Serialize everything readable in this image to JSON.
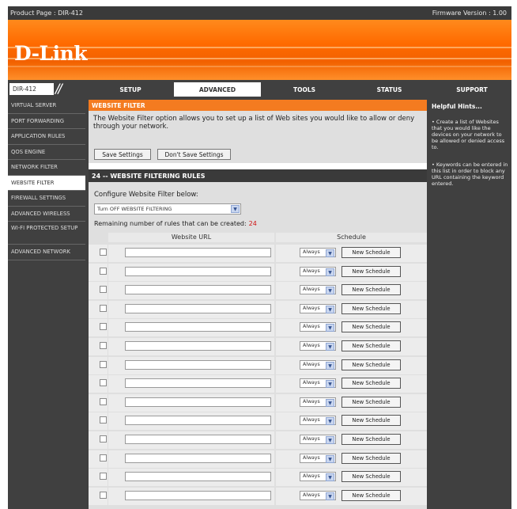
{
  "topbar": {
    "product": "Product Page : DIR-412",
    "firmware": "Firmware Version : 1.00"
  },
  "brand": {
    "logo": "D-Link"
  },
  "nav": {
    "model": "DIR-412",
    "tabs": [
      {
        "label": "SETUP",
        "active": false
      },
      {
        "label": "ADVANCED",
        "active": true
      },
      {
        "label": "TOOLS",
        "active": false
      },
      {
        "label": "STATUS",
        "active": false
      },
      {
        "label": "SUPPORT",
        "active": false
      }
    ]
  },
  "sidebar": {
    "items": [
      {
        "label": "VIRTUAL SERVER",
        "active": false
      },
      {
        "label": "PORT FORWARDING",
        "active": false
      },
      {
        "label": "APPLICATION RULES",
        "active": false
      },
      {
        "label": "QOS ENGINE",
        "active": false
      },
      {
        "label": "NETWORK FILTER",
        "active": false
      },
      {
        "label": "WEBSITE FILTER",
        "active": true
      },
      {
        "label": "FIREWALL SETTINGS",
        "active": false
      },
      {
        "label": "ADVANCED WIRELESS",
        "active": false
      },
      {
        "label": "WI-FI PROTECTED SETUP",
        "active": false
      },
      {
        "label": "ADVANCED NETWORK",
        "active": false
      }
    ]
  },
  "website_filter": {
    "title": "WEBSITE FILTER",
    "description": "The Website Filter option allows you to set up a list of Web sites you would like to allow or deny through your network.",
    "save_label": "Save Settings",
    "dont_save_label": "Don't Save Settings"
  },
  "rules": {
    "heading": "24 -- WEBSITE FILTERING RULES",
    "configure_label": "Configure Website Filter below:",
    "filter_mode": "Turn OFF WEBSITE FILTERING",
    "remaining_label": "Remaining number of rules that can be created:",
    "remaining_count": "24",
    "col_url": "Website URL",
    "col_schedule": "Schedule",
    "rows": [
      {
        "schedule": "Always",
        "button": "New Schedule"
      },
      {
        "schedule": "Always",
        "button": "New Schedule"
      },
      {
        "schedule": "Always",
        "button": "New Schedule"
      },
      {
        "schedule": "Always",
        "button": "New Schedule"
      },
      {
        "schedule": "Always",
        "button": "New Schedule"
      },
      {
        "schedule": "Always",
        "button": "New Schedule"
      },
      {
        "schedule": "Always",
        "button": "New Schedule"
      },
      {
        "schedule": "Always",
        "button": "New Schedule"
      },
      {
        "schedule": "Always",
        "button": "New Schedule"
      },
      {
        "schedule": "Always",
        "button": "New Schedule"
      },
      {
        "schedule": "Always",
        "button": "New Schedule"
      },
      {
        "schedule": "Always",
        "button": "New Schedule"
      },
      {
        "schedule": "Always",
        "button": "New Schedule"
      },
      {
        "schedule": "Always",
        "button": "New Schedule"
      }
    ]
  },
  "hints": {
    "title": "Helpful Hints...",
    "hint1": "Create a list of Websites that you would like the devices on your network to be allowed or denied access to.",
    "hint2": "Keywords can be entered in this list in order to block any URL containing the keyword entered."
  },
  "colors": {
    "accent": "#f47b20",
    "dark": "#404040",
    "panel": "#dfdfdf",
    "alert": "#d01010"
  }
}
